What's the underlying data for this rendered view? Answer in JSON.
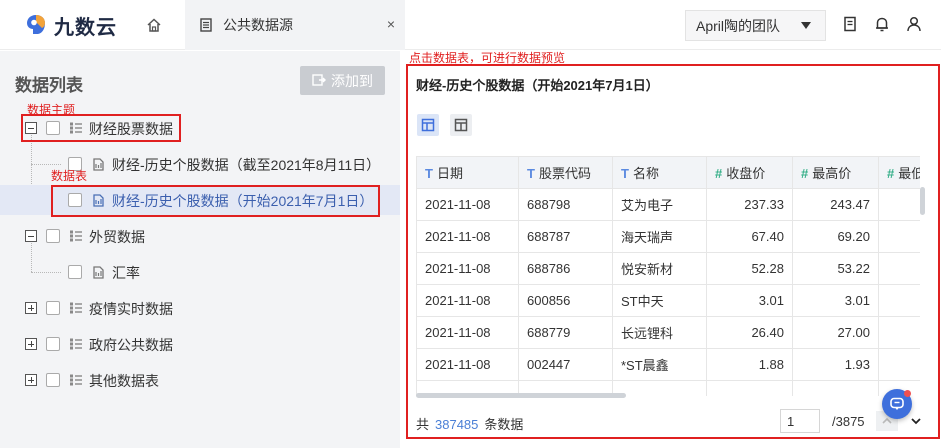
{
  "header": {
    "logo_text": "九数云",
    "active_tab_label": "公共数据源",
    "tab_close": "×",
    "team_name": "April陶的团队"
  },
  "sidebar": {
    "title": "数据列表",
    "add_button_label": "添加到",
    "annotation_theme": "数据主题",
    "annotation_table": "数据表",
    "tree": [
      {
        "label": "财经股票数据",
        "type": "folder",
        "expanded": true
      },
      {
        "label": "财经-历史个股数据（截至2021年8月11日）",
        "type": "table"
      },
      {
        "label": "财经-历史个股数据（开始2021年7月1日）",
        "type": "table",
        "selected": true
      },
      {
        "label": "外贸数据",
        "type": "folder",
        "expanded": true
      },
      {
        "label": "汇率",
        "type": "table"
      },
      {
        "label": "疫情实时数据",
        "type": "folder",
        "expanded": false
      },
      {
        "label": "政府公共数据",
        "type": "folder",
        "expanded": false
      },
      {
        "label": "其他数据表",
        "type": "folder",
        "expanded": false
      }
    ]
  },
  "preview": {
    "annotation": "点击数据表，可进行数据预览",
    "title": "财经-历史个股数据（开始2021年7月1日）",
    "columns": [
      {
        "type": "T",
        "label": "日期"
      },
      {
        "type": "T",
        "label": "股票代码"
      },
      {
        "type": "T",
        "label": "名称"
      },
      {
        "type": "#",
        "label": "收盘价"
      },
      {
        "type": "#",
        "label": "最高价"
      },
      {
        "type": "#",
        "label": "最低价"
      }
    ],
    "rows": [
      [
        "2021-11-08",
        "688798",
        "艾为电子",
        "237.33",
        "243.47",
        ""
      ],
      [
        "2021-11-08",
        "688787",
        "海天瑞声",
        "67.40",
        "69.20",
        ""
      ],
      [
        "2021-11-08",
        "688786",
        "悦安新材",
        "52.28",
        "53.22",
        ""
      ],
      [
        "2021-11-08",
        "600856",
        "ST中天",
        "3.01",
        "3.01",
        ""
      ],
      [
        "2021-11-08",
        "688779",
        "长远锂科",
        "26.40",
        "27.00",
        ""
      ],
      [
        "2021-11-08",
        "002447",
        "*ST晨鑫",
        "1.88",
        "1.93",
        ""
      ],
      [
        "",
        "",
        "",
        "",
        "",
        ""
      ]
    ],
    "footer": {
      "prefix": "共",
      "count": "387485",
      "suffix": "条数据",
      "page": "1",
      "total_pages": "/3875"
    }
  },
  "colors": {
    "accent": "#3e6fdc",
    "annotation_red": "#e02020",
    "number_type": "#38b08a",
    "text_type": "#5b8ae0"
  }
}
